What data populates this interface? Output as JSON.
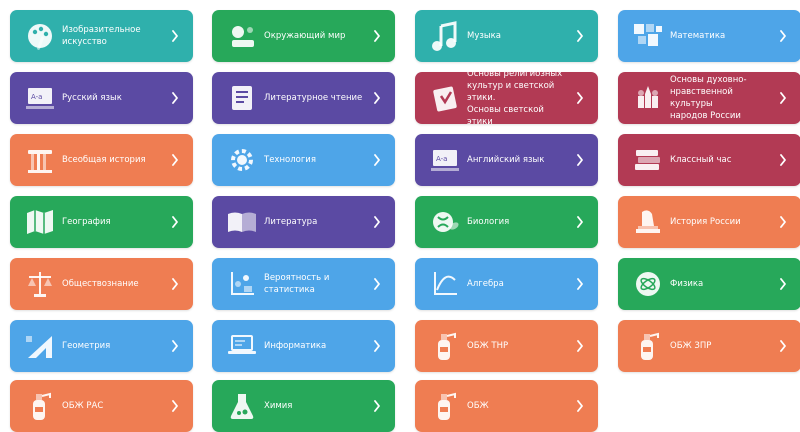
{
  "colors": {
    "teal": "#2fb0ac",
    "green": "#27a85a",
    "purple": "#5b4aa3",
    "blue": "#4ea5e8",
    "crimson": "#b23a54",
    "orange": "#ef7d52"
  },
  "tiles": [
    {
      "label": "Изобразительное\nискусство",
      "color": "teal",
      "icon": "palette-icon"
    },
    {
      "label": "Окружающий мир",
      "color": "green",
      "icon": "world-icon"
    },
    {
      "label": "Музыка",
      "color": "teal",
      "icon": "music-note-icon"
    },
    {
      "label": "Математика",
      "color": "blue",
      "icon": "math-icon"
    },
    {
      "label": "Русский язык",
      "color": "purple",
      "icon": "alphabet-board-icon"
    },
    {
      "label": "Литературное чтение",
      "color": "purple",
      "icon": "book-icon"
    },
    {
      "label": "Основы религиозных\nкультур и светской этики.\nОсновы светской этики",
      "color": "crimson",
      "icon": "religion-book-icon"
    },
    {
      "label": "Основы духовно-\nнравственной культуры\nнародов России",
      "color": "crimson",
      "icon": "kremlin-icon"
    },
    {
      "label": "Всеобщая история",
      "color": "orange",
      "icon": "column-icon"
    },
    {
      "label": "Технология",
      "color": "blue",
      "icon": "gear-icon"
    },
    {
      "label": "Английский язык",
      "color": "purple",
      "icon": "alphabet-board-icon"
    },
    {
      "label": "Классный час",
      "color": "crimson",
      "icon": "books-stack-icon"
    },
    {
      "label": "География",
      "color": "green",
      "icon": "map-icon"
    },
    {
      "label": "Литература",
      "color": "purple",
      "icon": "open-book-icon"
    },
    {
      "label": "Биология",
      "color": "green",
      "icon": "dna-leaf-icon"
    },
    {
      "label": "История России",
      "color": "orange",
      "icon": "monument-icon"
    },
    {
      "label": "Обществознание",
      "color": "orange",
      "icon": "scales-icon"
    },
    {
      "label": "Вероятность и статистика",
      "color": "blue",
      "icon": "statistics-icon"
    },
    {
      "label": "Алгебра",
      "color": "blue",
      "icon": "graph-icon"
    },
    {
      "label": "Физика",
      "color": "green",
      "icon": "atom-icon"
    },
    {
      "label": "Геометрия",
      "color": "blue",
      "icon": "ruler-triangle-icon"
    },
    {
      "label": "Информатика",
      "color": "blue",
      "icon": "laptop-icon"
    },
    {
      "label": "ОБЖ ТНР",
      "color": "orange",
      "icon": "extinguisher-icon"
    },
    {
      "label": "ОБЖ ЗПР",
      "color": "orange",
      "icon": "extinguisher-icon"
    },
    {
      "label": "ОБЖ РАС",
      "color": "orange",
      "icon": "extinguisher-icon"
    },
    {
      "label": "Химия",
      "color": "green",
      "icon": "flask-icon"
    },
    {
      "label": "ОБЖ",
      "color": "orange",
      "icon": "extinguisher-icon"
    }
  ]
}
